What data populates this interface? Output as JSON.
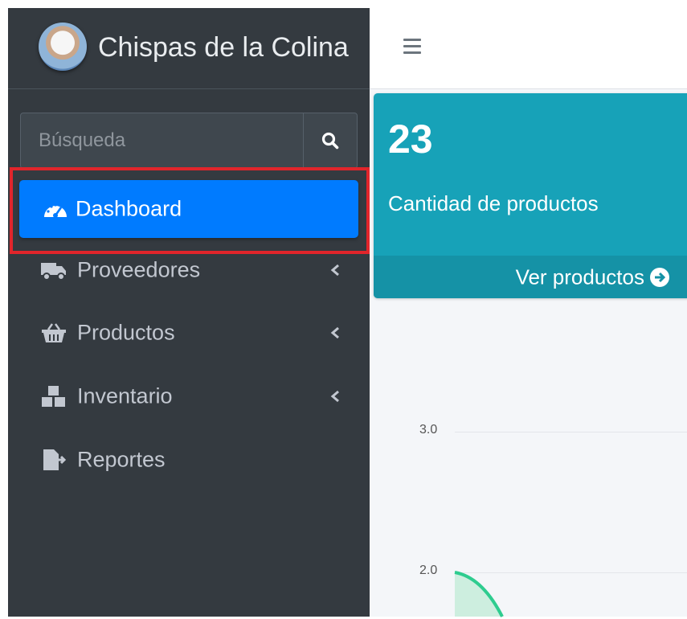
{
  "brand": {
    "name": "Chispas de la Colina"
  },
  "search": {
    "placeholder": "Búsqueda"
  },
  "nav": {
    "active": {
      "label": "Dashboard",
      "icon": "tachometer-icon"
    },
    "items": [
      {
        "label": "Proveedores",
        "icon": "truck-icon"
      },
      {
        "label": "Productos",
        "icon": "basket-icon"
      },
      {
        "label": "Inventario",
        "icon": "boxes-icon"
      },
      {
        "label": "Reportes",
        "icon": "file-export-icon"
      }
    ]
  },
  "card": {
    "count": "23",
    "label": "Cantidad de productos",
    "footer": "Ver productos",
    "color": "#17a2b8"
  },
  "chart_data": {
    "type": "area",
    "y_ticks": [
      "3.0",
      "2.0"
    ],
    "color": "#2ecc8f"
  },
  "colors": {
    "sidebar": "#343a40",
    "active": "#007bff",
    "highlight": "#e1252b"
  }
}
